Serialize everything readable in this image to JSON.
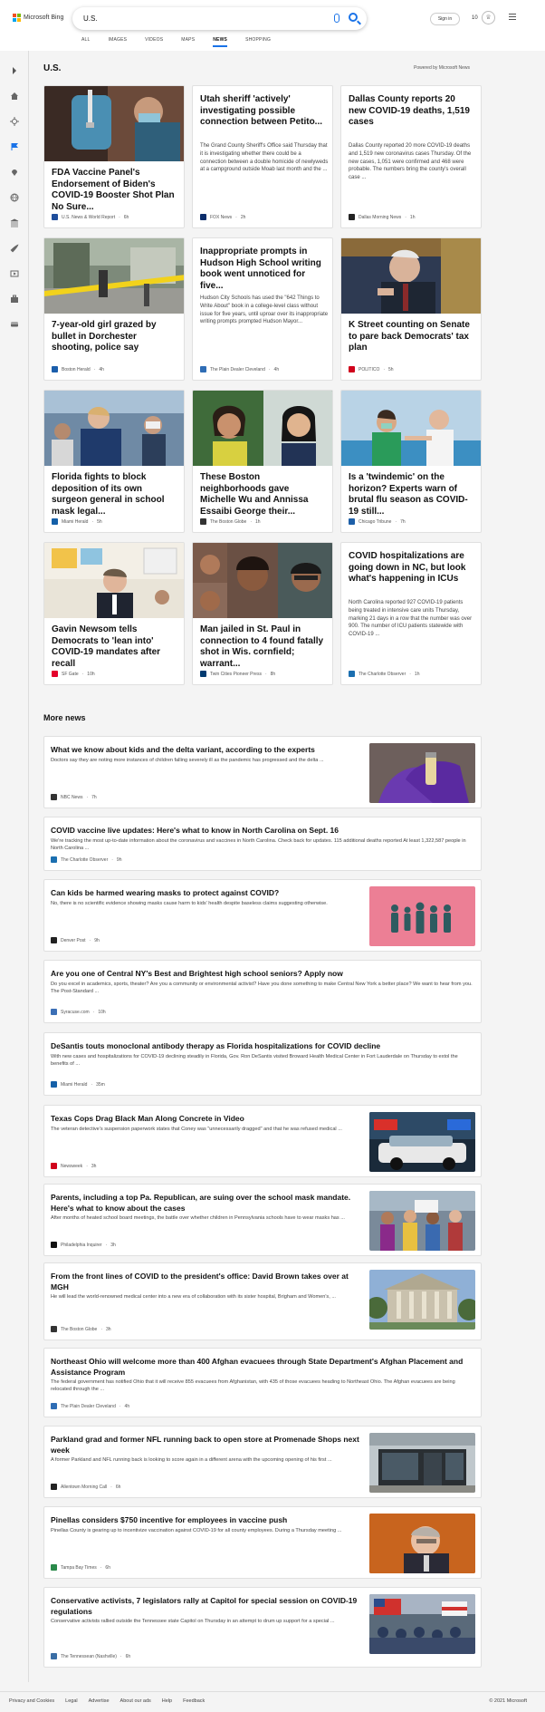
{
  "header": {
    "brand": "Microsoft Bing",
    "search_value": "U.S.",
    "signin": "Sign in",
    "points": "10",
    "tabs": [
      "ALL",
      "IMAGES",
      "VIDEOS",
      "MAPS",
      "NEWS",
      "SHOPPING"
    ],
    "active_tab": "NEWS"
  },
  "section": {
    "title": "U.S.",
    "powered_by": "Powered by Microsoft News"
  },
  "cards": [
    {
      "title": "FDA Vaccine Panel's Endorsement of Biden's COVID-19 Booster Shot Plan No Sure...",
      "source": "U.S. News & World Report",
      "age": "6h",
      "snippet": "",
      "image": "vaccine-syringe",
      "fav": "#1f4e9c"
    },
    {
      "title": "Utah sheriff 'actively' investigating possible connection between Petito...",
      "source": "FOX News",
      "age": "2h",
      "snippet": "The Grand County Sheriff's Office said Thursday that it is investigating whether there could be a connection between a double homicide of newlyweds at a campground outside Moab last month and the ...",
      "image": "",
      "fav": "#0b2d6b"
    },
    {
      "title": "Dallas County reports 20 new COVID-19 deaths, 1,519 cases",
      "source": "Dallas Morning News",
      "age": "1h",
      "snippet": "Dallas County reported 20 more COVID-19 deaths and 1,519 new coronavirus cases Thursday. Of the new cases, 1,051 were confirmed and 468 were probable. The numbers bring the county's overall case ...",
      "image": "",
      "fav": "#222222"
    },
    {
      "title": "7-year-old girl grazed by bullet in Dorchester shooting, police say",
      "source": "Boston Herald",
      "age": "4h",
      "snippet": "",
      "image": "crime-scene-tape",
      "fav": "#1b5eab"
    },
    {
      "title": "Inappropriate prompts in Hudson High School writing book went unnoticed for five...",
      "source": "The Plain Dealer Cleveland",
      "age": "4h",
      "snippet": "Hudson City Schools has used the \"642 Things to Write About\" book in a college-level class without issue for five years, until uproar over its inappropriate writing prompts prompted Hudson Mayor...",
      "image": "",
      "fav": "#2f6db5"
    },
    {
      "title": "K Street counting on Senate to pare back Democrats' tax plan",
      "source": "POLITICO",
      "age": "5h",
      "snippet": "",
      "image": "congressman",
      "fav": "#d0021b"
    },
    {
      "title": "Florida fights to block deposition of its own surgeon general in school mask legal...",
      "source": "Miami Herald",
      "age": "5h",
      "snippet": "",
      "image": "officials-press",
      "fav": "#1560a8"
    },
    {
      "title": "These Boston neighborhoods gave Michelle Wu and Annissa Essaibi George their...",
      "source": "The Boston Globe",
      "age": "1h",
      "snippet": "",
      "image": "two-candidates",
      "fav": "#333333"
    },
    {
      "title": "Is a 'twindemic' on the horizon? Experts warn of brutal flu season as COVID-19 still...",
      "source": "Chicago Tribune",
      "age": "7h",
      "snippet": "",
      "image": "flu-shot",
      "fav": "#1d5fa8"
    },
    {
      "title": "Gavin Newsom tells Democrats to 'lean into' COVID-19 mandates after recall",
      "source": "SF Gate",
      "age": "10h",
      "snippet": "",
      "image": "newsom-classroom",
      "fav": "#e4002b"
    },
    {
      "title": "Man jailed in St. Paul in connection to 4 found fatally shot in Wis. cornfield; warrant...",
      "source": "Twin Cities Pioneer Press",
      "age": "8h",
      "snippet": "",
      "image": "victims-collage",
      "fav": "#003a70"
    },
    {
      "title": "COVID hospitalizations are going down in NC, but look what's happening in ICUs",
      "source": "The Charlotte Observer",
      "age": "1h",
      "snippet": "North Carolina reported 927 COVID-19 patients being treated in intensive care units Thursday, marking 21 days in a row that the number was over 900. The number of ICU patients statewide with COVID-19 ...",
      "image": "",
      "fav": "#1b6fb0"
    }
  ],
  "more_news_title": "More news",
  "more_news": [
    {
      "title": "What we know about kids and the delta variant, according to the experts",
      "snippet": "Doctors say they are noting more instances of children falling severely ill as the pandemic has progressed and the delta ...",
      "source": "NBC News",
      "age": "7h",
      "image": "glove-vial",
      "fav": "#333333"
    },
    {
      "title": "COVID vaccine live updates: Here's what to know in North Carolina on Sept. 16",
      "snippet": "We're tracking the most up-to-date information about the coronavirus and vaccines in North Carolina. Check back for updates. 115 additional deaths reported At least 1,322,587 people in North Carolina ...",
      "source": "The Charlotte Observer",
      "age": "9h",
      "image": "",
      "fav": "#1b6fb0"
    },
    {
      "title": "Can kids be harmed wearing masks to protect against COVID?",
      "snippet": "No, there is no scientific evidence showing masks cause harm to kids' health despite baseless claims suggesting otherwise.",
      "source": "Denver Post",
      "age": "9h",
      "image": "masked-family",
      "fav": "#222222"
    },
    {
      "title": "Are you one of Central NY's Best and Brightest high school seniors? Apply now",
      "snippet": "Do you excel in academics, sports, theater? Are you a community or environmental activist? Have you done something to make Central New York a better place? We want to hear from you. The Post-Standard ...",
      "source": "Syracuse.com",
      "age": "10h",
      "image": "",
      "fav": "#3b6fb6"
    },
    {
      "title": "DeSantis touts monoclonal antibody therapy as Florida hospitalizations for COVID decline",
      "snippet": "With new cases and hospitalizations for COVID-19 declining steadily in Florida, Gov. Ron DeSantis visited Broward Health Medical Center in Fort Lauderdale on Thursday to extol the benefits of ...",
      "source": "Miami Herald",
      "age": "35m",
      "image": "",
      "fav": "#1560a8"
    },
    {
      "title": "Texas Cops Drag Black Man Along Concrete in Video",
      "snippet": "The veteran detective's suspension paperwork states that Coney was \"unnecessarily dragged\" and that he was refused medical ...",
      "source": "Newsweek",
      "age": "3h",
      "image": "police-car",
      "fav": "#d0021b"
    },
    {
      "title": "Parents, including a top Pa. Republican, are suing over the school mask mandate. Here's what to know about the cases",
      "snippet": "After months of heated school board meetings, the battle over whether children in Pennsylvania schools have to wear masks has ...",
      "source": "Philadelphia Inquirer",
      "age": "3h",
      "image": "protest-crowd",
      "fav": "#111111"
    },
    {
      "title": "From the front lines of COVID to the president's office: David Brown takes over at MGH",
      "snippet": "He will lead the world-renowned medical center into a new era of collaboration with its sister hospital, Brigham and Women's, ...",
      "source": "The Boston Globe",
      "age": "3h",
      "image": "mgh-building",
      "fav": "#333333"
    },
    {
      "title": "Northeast Ohio will welcome more than 400 Afghan evacuees through State Department's Afghan Placement and Assistance Program",
      "snippet": "The federal government has notified Ohio that it will receive 855 evacuees from Afghanistan, with 435 of those evacuees heading to Northeast Ohio. The Afghan evacuees are being relocated through the ...",
      "source": "The Plain Dealer Cleveland",
      "age": "4h",
      "image": "",
      "fav": "#2f6db5"
    },
    {
      "title": "Parkland grad and former NFL running back to open store at Promenade Shops next week",
      "snippet": "A former Parkland and NFL running back is looking to score again in a different arena with the upcoming opening of his first ...",
      "source": "Allentown Morning Call",
      "age": "6h",
      "image": "storefront",
      "fav": "#222222"
    },
    {
      "title": "Pinellas considers $750 incentive for employees in vaccine push",
      "snippet": "Pinellas County is gearing up to incentivize vaccination against COVID-19 for all county employees. During a Thursday meeting ...",
      "source": "Tampa Bay Times",
      "age": "6h",
      "image": "official-portrait",
      "fav": "#2a8a4a"
    },
    {
      "title": "Conservative activists, 7 legislators rally at Capitol for special session on COVID-19 regulations",
      "snippet": "Conservative activists rallied outside the Tennessee state Capitol on Thursday in an attempt to drum up support for a special ...",
      "source": "The Tennessean (Nashville)",
      "age": "6h",
      "image": "rally-flags",
      "fav": "#3a6ea5"
    }
  ],
  "footer": {
    "links": [
      "Privacy and Cookies",
      "Legal",
      "Advertise",
      "About our ads",
      "Help",
      "Feedback"
    ],
    "copyright": "© 2021 Microsoft"
  }
}
